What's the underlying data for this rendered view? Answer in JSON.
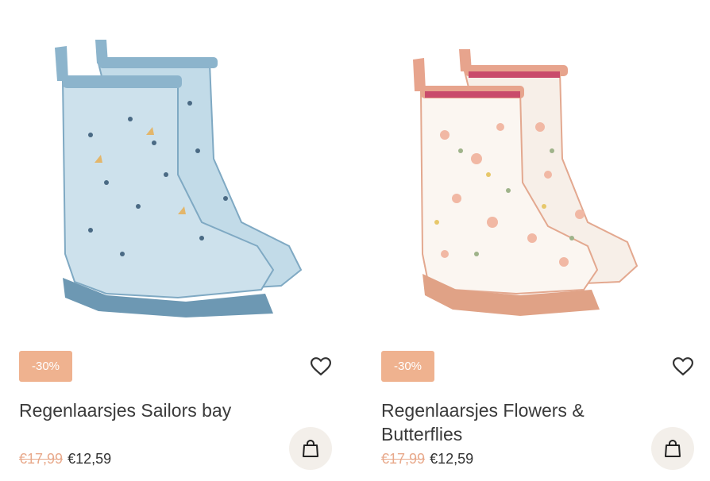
{
  "colors": {
    "badge": "#efb28f",
    "old_price": "#e8a98b",
    "text": "#333333",
    "cart_bg": "#f3efea"
  },
  "products": [
    {
      "badge": "-30%",
      "title": "Regenlaarsjes Sailors bay",
      "old_price": "€17,99",
      "new_price": "€12,59",
      "image_alt": "Light blue children's rain boots with sailboat print",
      "wishlist_icon": "heart-icon",
      "cart_icon": "shopping-bag-icon"
    },
    {
      "badge": "-30%",
      "title": "Regenlaarsjes Flowers & Butterflies",
      "old_price": "€17,99",
      "new_price": "€12,59",
      "image_alt": "Cream children's rain boots with pink floral print",
      "wishlist_icon": "heart-icon",
      "cart_icon": "shopping-bag-icon"
    }
  ]
}
